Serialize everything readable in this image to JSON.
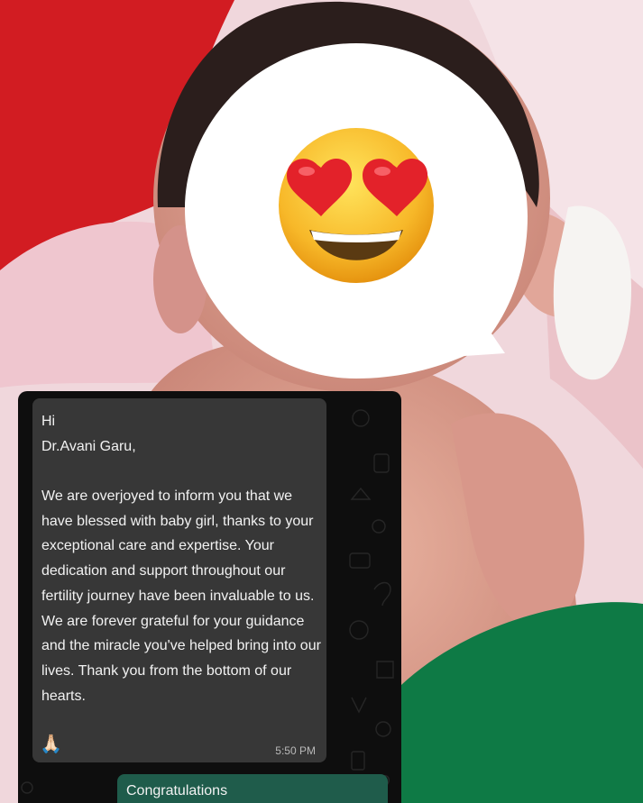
{
  "message_in": {
    "greeting": "Hi\nDr.Avani Garu,",
    "body": "We are overjoyed to inform you that we have blessed with baby girl, thanks to your exceptional care and expertise. Your dedication and support throughout our fertility journey have been invaluable to us. We are forever grateful for your guidance and the miracle you've helped bring into our lives. Thank you from the bottom of our hearts.",
    "emoji": "🙏🏻",
    "time": "5:50 PM"
  },
  "message_out": {
    "text": "Congratulations"
  },
  "overlay": {
    "face_emoji_name": "heart-eyes-emoji-icon"
  },
  "colors": {
    "chat_bg": "#0e0e0e",
    "incoming_bubble": "#373737",
    "outgoing_bubble": "#1f5c4b",
    "blanket_red": "#d21c22",
    "blanket_green": "#0e7a45"
  }
}
